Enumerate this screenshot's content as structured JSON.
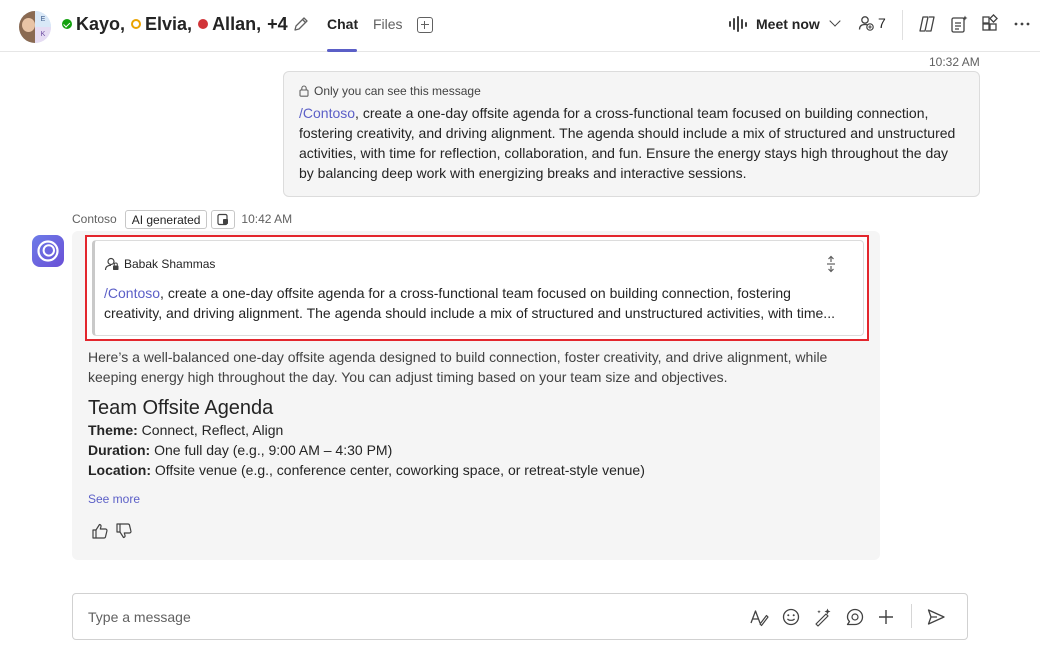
{
  "header": {
    "participants": [
      {
        "name": "Kayo,",
        "status": "available"
      },
      {
        "name": "Elvia,",
        "status": "away"
      },
      {
        "name": "Allan,",
        "status": "busy"
      }
    ],
    "extra_count": "+4",
    "avatar_initials": [
      "E",
      "K"
    ],
    "tabs": [
      {
        "label": "Chat",
        "active": true
      },
      {
        "label": "Files",
        "active": false
      }
    ],
    "meet_label": "Meet now",
    "people_count": "7"
  },
  "conversation": {
    "user_message": {
      "timestamp": "10:32 AM",
      "visibility_note": "Only you can see this message",
      "mention": "/Contoso",
      "text": ", create a one-day offsite agenda for a cross-functional team focused on building connection, fostering creativity, and driving alignment. The agenda should include a mix of structured and unstructured activities, with time for reflection, collaboration, and fun. Ensure the energy stays high throughout the day by balancing deep work with energizing breaks and interactive sessions."
    },
    "bot_message": {
      "sender": "Contoso",
      "ai_badge": "AI generated",
      "timestamp": "10:42 AM",
      "quote": {
        "author": "Babak Shammas",
        "mention": "/Contoso",
        "line1": ", create a one-day offsite agenda for a cross-functional team focused on building connection, fostering",
        "line2": "creativity, and driving alignment. The agenda should include a mix of structured and unstructured activities, with time..."
      },
      "intro": "Here’s a well-balanced one-day offsite agenda designed to build connection, foster creativity, and drive alignment, while keeping energy high throughout the day. You can adjust timing based on your team size and objectives.",
      "agenda_title": "Team Offsite Agenda",
      "details": [
        {
          "label": "Theme:",
          "value": " Connect, Reflect, Align"
        },
        {
          "label": "Duration:",
          "value": " One full day (e.g., 9:00 AM – 4:30 PM)"
        },
        {
          "label": "Location:",
          "value": " Offsite venue (e.g., conference center, coworking space, or retreat-style venue)"
        }
      ],
      "see_more": "See more"
    }
  },
  "compose": {
    "placeholder": "Type a message"
  },
  "colors": {
    "accent": "#5b5fc7",
    "highlight_border": "#e3262d",
    "available": "#13a10e",
    "away": "#eaa300",
    "busy": "#d13438"
  }
}
